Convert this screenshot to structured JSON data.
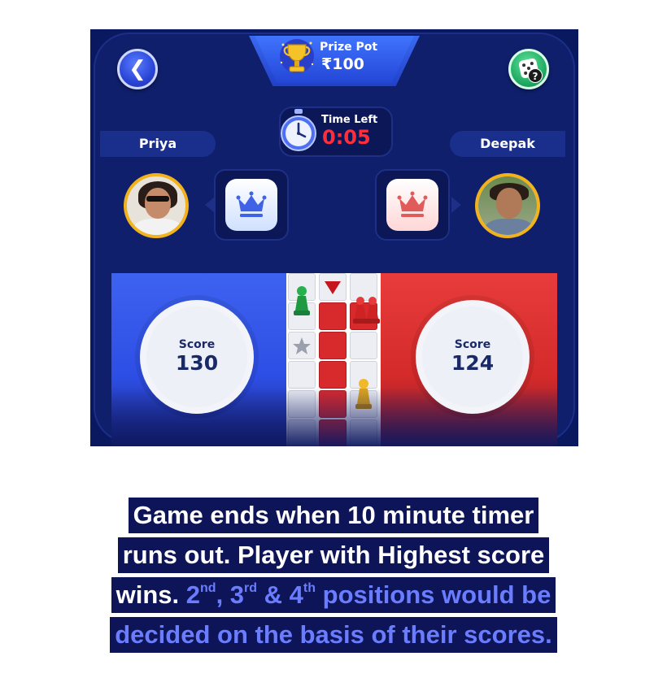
{
  "header": {
    "prize_pot_label": "Prize Pot",
    "prize_pot_amount": "₹100",
    "time_left_label": "Time Left",
    "time_left_value": "0:05"
  },
  "players": {
    "left": {
      "name": "Priya",
      "score_label": "Score",
      "score": "130",
      "color": "#2d4ee4"
    },
    "right": {
      "name": "Deepak",
      "score_label": "Score",
      "score": "124",
      "color": "#d42a2a"
    }
  },
  "icons": {
    "back": "chevron-left-icon",
    "help": "dice-help-icon",
    "trophy": "trophy-icon",
    "clock": "stopwatch-icon",
    "crown": "crown-icon",
    "star": "star-icon"
  },
  "caption": {
    "line1": "Game ends when 10 minute timer",
    "line2": "runs out. Player with Highest score",
    "line3_a": "wins.",
    "line3_b_2": "2",
    "sup_nd": "nd",
    "sep1": ", ",
    "line3_b_3": "3",
    "sup_rd": "rd",
    "amp": " & ",
    "line3_b_4": "4",
    "sup_th": "th",
    "line3_c": " positions would be",
    "line4": "decided on the basis of their scores."
  },
  "colors": {
    "accent_blue": "#2d4ee4",
    "accent_red": "#d42a2a",
    "timer_red": "#ff2e3a",
    "gold": "#f2b21c",
    "caption_bg": "#0e1458",
    "caption_highlight": "#6a7dff"
  }
}
